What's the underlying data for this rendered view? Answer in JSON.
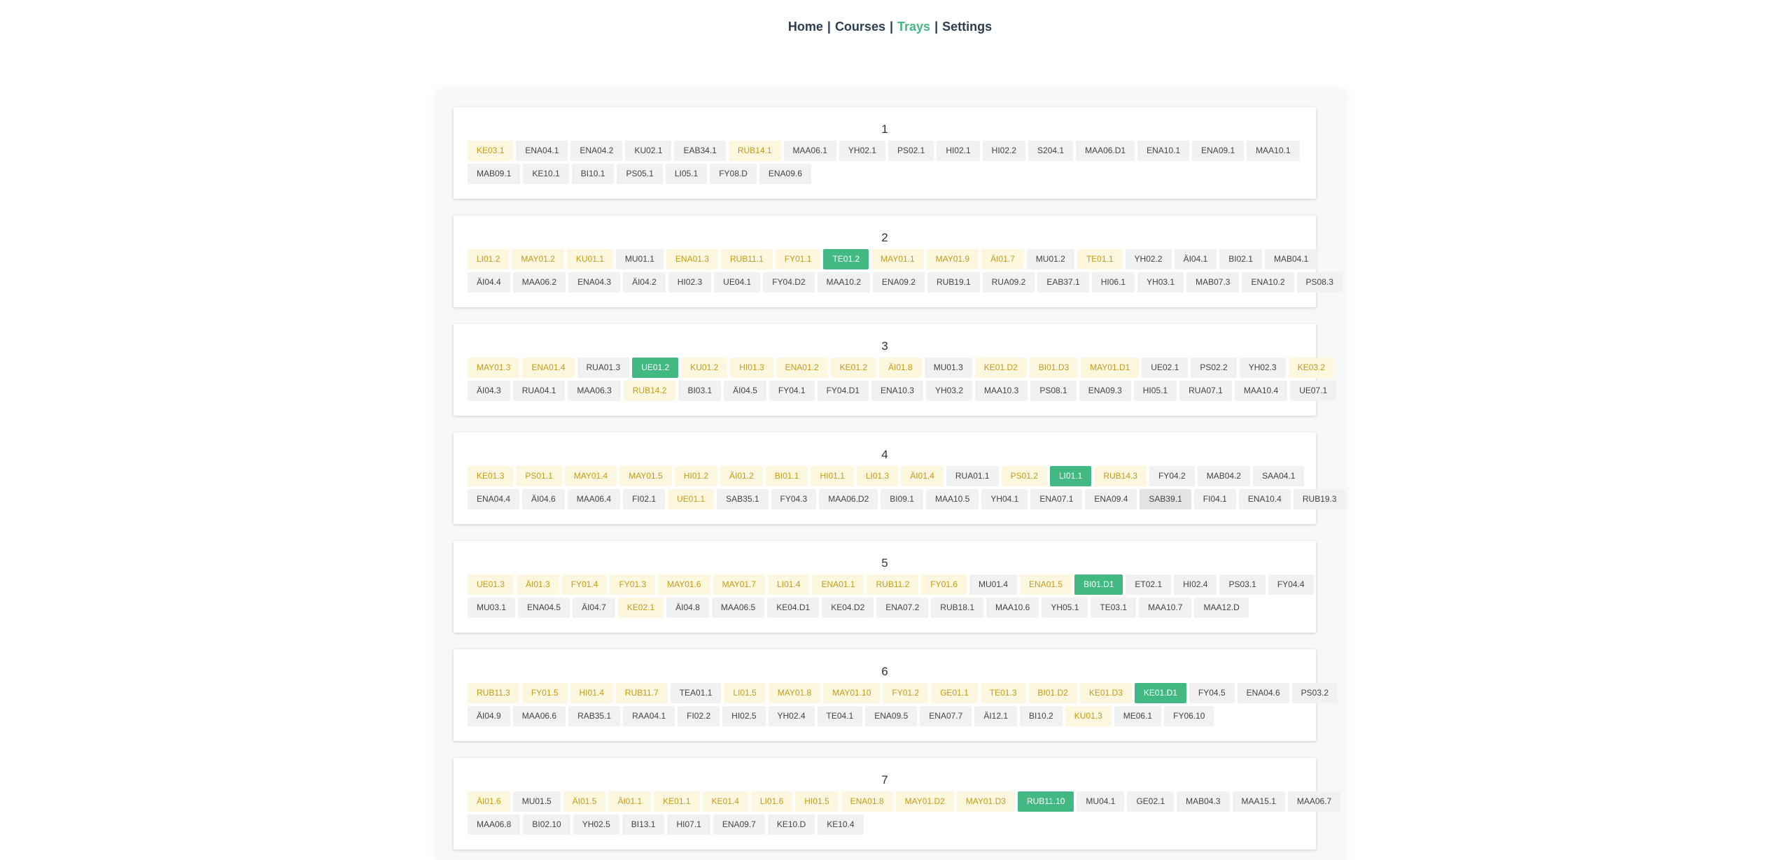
{
  "nav": {
    "items": [
      "Home",
      "Courses",
      "Trays",
      "Settings"
    ],
    "separator": "|",
    "active": "Trays",
    "active_color": "#42b983"
  },
  "legend_colors": {
    "default": "#f1f1f1",
    "yellow": "#fdf7e0",
    "green": "#42b983"
  },
  "trays": [
    {
      "title": "1",
      "rows": [
        [
          [
            "KE03.1",
            "y"
          ],
          [
            "ENA04.1",
            "n"
          ],
          [
            "ENA04.2",
            "n"
          ],
          [
            "KU02.1",
            "n"
          ],
          [
            "EAB34.1",
            "n"
          ],
          [
            "RUB14.1",
            "y"
          ],
          [
            "MAA06.1",
            "n"
          ],
          [
            "YH02.1",
            "n"
          ],
          [
            "PS02.1",
            "n"
          ],
          [
            "HI02.1",
            "n"
          ],
          [
            "HI02.2",
            "n"
          ],
          [
            "S204.1",
            "n"
          ],
          [
            "MAA06.D1",
            "n"
          ],
          [
            "ENA10.1",
            "n"
          ],
          [
            "ENA09.1",
            "n"
          ],
          [
            "MAA10.1",
            "n"
          ]
        ],
        [
          [
            "MAB09.1",
            "n"
          ],
          [
            "KE10.1",
            "n"
          ],
          [
            "BI10.1",
            "n"
          ],
          [
            "PS05.1",
            "n"
          ],
          [
            "LI05.1",
            "n"
          ],
          [
            "FY08.D",
            "n"
          ],
          [
            "ENA09.6",
            "n"
          ]
        ]
      ]
    },
    {
      "title": "2",
      "rows": [
        [
          [
            "LI01.2",
            "y"
          ],
          [
            "MAY01.2",
            "y"
          ],
          [
            "KU01.1",
            "y"
          ],
          [
            "MU01.1",
            "n"
          ],
          [
            "ENA01.3",
            "y"
          ],
          [
            "RUB11.1",
            "y"
          ],
          [
            "FY01.1",
            "y"
          ],
          [
            "TE01.2",
            "g"
          ],
          [
            "MAY01.1",
            "y"
          ],
          [
            "MAY01.9",
            "y"
          ],
          [
            "ÄI01.7",
            "y"
          ],
          [
            "MU01.2",
            "n"
          ],
          [
            "TE01.1",
            "y"
          ],
          [
            "YH02.2",
            "n"
          ],
          [
            "ÄI04.1",
            "n"
          ],
          [
            "BI02.1",
            "n"
          ],
          [
            "MAB04.1",
            "n"
          ]
        ],
        [
          [
            "ÄI04.4",
            "n"
          ],
          [
            "MAA06.2",
            "n"
          ],
          [
            "ENA04.3",
            "n"
          ],
          [
            "ÄI04.2",
            "n"
          ],
          [
            "HI02.3",
            "n"
          ],
          [
            "UE04.1",
            "n"
          ],
          [
            "FY04.D2",
            "n"
          ],
          [
            "MAA10.2",
            "n"
          ],
          [
            "ENA09.2",
            "n"
          ],
          [
            "RUB19.1",
            "n"
          ],
          [
            "RUA09.2",
            "n"
          ],
          [
            "EAB37.1",
            "n"
          ],
          [
            "HI06.1",
            "n"
          ],
          [
            "YH03.1",
            "n"
          ],
          [
            "MAB07.3",
            "n"
          ],
          [
            "ENA10.2",
            "n"
          ],
          [
            "PS08.3",
            "n"
          ]
        ]
      ]
    },
    {
      "title": "3",
      "rows": [
        [
          [
            "MAY01.3",
            "y"
          ],
          [
            "ENA01.4",
            "y"
          ],
          [
            "RUA01.3",
            "n"
          ],
          [
            "UE01.2",
            "g"
          ],
          [
            "KU01.2",
            "y"
          ],
          [
            "HI01.3",
            "y"
          ],
          [
            "ENA01.2",
            "y"
          ],
          [
            "KE01.2",
            "y"
          ],
          [
            "ÄI01.8",
            "y"
          ],
          [
            "MU01.3",
            "n"
          ],
          [
            "KE01.D2",
            "y"
          ],
          [
            "BI01.D3",
            "y"
          ],
          [
            "MAY01.D1",
            "y"
          ],
          [
            "UE02.1",
            "n"
          ],
          [
            "PS02.2",
            "n"
          ],
          [
            "YH02.3",
            "n"
          ],
          [
            "KE03.2",
            "y"
          ]
        ],
        [
          [
            "ÄI04.3",
            "n"
          ],
          [
            "RUA04.1",
            "n"
          ],
          [
            "MAA06.3",
            "n"
          ],
          [
            "RUB14.2",
            "y"
          ],
          [
            "BI03.1",
            "n"
          ],
          [
            "ÄI04.5",
            "n"
          ],
          [
            "FY04.1",
            "n"
          ],
          [
            "FY04.D1",
            "n"
          ],
          [
            "ENA10.3",
            "n"
          ],
          [
            "YH03.2",
            "n"
          ],
          [
            "MAA10.3",
            "n"
          ],
          [
            "PS08.1",
            "n"
          ],
          [
            "ENA09.3",
            "n"
          ],
          [
            "HI05.1",
            "n"
          ],
          [
            "RUA07.1",
            "n"
          ],
          [
            "MAA10.4",
            "n"
          ],
          [
            "UE07.1",
            "n"
          ]
        ]
      ]
    },
    {
      "title": "4",
      "rows": [
        [
          [
            "KE01.3",
            "y"
          ],
          [
            "PS01.1",
            "y"
          ],
          [
            "MAY01.4",
            "y"
          ],
          [
            "MAY01.5",
            "y"
          ],
          [
            "HI01.2",
            "y"
          ],
          [
            "ÄI01.2",
            "y"
          ],
          [
            "BI01.1",
            "y"
          ],
          [
            "HI01.1",
            "y"
          ],
          [
            "LI01.3",
            "y"
          ],
          [
            "ÄI01.4",
            "y"
          ],
          [
            "RUA01.1",
            "n"
          ],
          [
            "PS01.2",
            "y"
          ],
          [
            "LI01.1",
            "g"
          ],
          [
            "RUB14.3",
            "y"
          ],
          [
            "FY04.2",
            "n"
          ],
          [
            "MAB04.2",
            "n"
          ],
          [
            "SAA04.1",
            "n"
          ]
        ],
        [
          [
            "ENA04.4",
            "n"
          ],
          [
            "ÄI04.6",
            "n"
          ],
          [
            "MAA06.4",
            "n"
          ],
          [
            "FI02.1",
            "n"
          ],
          [
            "UE01.1",
            "y"
          ],
          [
            "SAB35.1",
            "n"
          ],
          [
            "FY04.3",
            "n"
          ],
          [
            "MAA06.D2",
            "n"
          ],
          [
            "BI09.1",
            "n"
          ],
          [
            "MAA10.5",
            "n"
          ],
          [
            "YH04.1",
            "n"
          ],
          [
            "ENA07.1",
            "n"
          ],
          [
            "ENA09.4",
            "n"
          ],
          [
            "SAB39.1",
            "d"
          ],
          [
            "FI04.1",
            "n"
          ],
          [
            "ENA10.4",
            "n"
          ],
          [
            "RUB19.3",
            "n"
          ]
        ]
      ]
    },
    {
      "title": "5",
      "rows": [
        [
          [
            "UE01.3",
            "y"
          ],
          [
            "ÄI01.3",
            "y"
          ],
          [
            "FY01.4",
            "y"
          ],
          [
            "FY01.3",
            "y"
          ],
          [
            "MAY01.6",
            "y"
          ],
          [
            "MAY01.7",
            "y"
          ],
          [
            "LI01.4",
            "y"
          ],
          [
            "ENA01.1",
            "y"
          ],
          [
            "RUB11.2",
            "y"
          ],
          [
            "FY01.6",
            "y"
          ],
          [
            "MU01.4",
            "n"
          ],
          [
            "ENA01.5",
            "y"
          ],
          [
            "BI01.D1",
            "g"
          ],
          [
            "ET02.1",
            "n"
          ],
          [
            "HI02.4",
            "n"
          ],
          [
            "PS03.1",
            "n"
          ],
          [
            "FY04.4",
            "n"
          ]
        ],
        [
          [
            "MU03.1",
            "n"
          ],
          [
            "ENA04.5",
            "n"
          ],
          [
            "ÄI04.7",
            "n"
          ],
          [
            "KE02.1",
            "y"
          ],
          [
            "ÄI04.8",
            "n"
          ],
          [
            "MAA06.5",
            "n"
          ],
          [
            "KE04.D1",
            "n"
          ],
          [
            "KE04.D2",
            "n"
          ],
          [
            "ENA07.2",
            "n"
          ],
          [
            "RUB18.1",
            "n"
          ],
          [
            "MAA10.6",
            "n"
          ],
          [
            "YH05.1",
            "n"
          ],
          [
            "TE03.1",
            "n"
          ],
          [
            "MAA10.7",
            "n"
          ],
          [
            "MAA12.D",
            "n"
          ]
        ]
      ]
    },
    {
      "title": "6",
      "rows": [
        [
          [
            "RUB11.3",
            "y"
          ],
          [
            "FY01.5",
            "y"
          ],
          [
            "HI01.4",
            "y"
          ],
          [
            "RUB11.7",
            "y"
          ],
          [
            "TEA01.1",
            "n"
          ],
          [
            "LI01.5",
            "y"
          ],
          [
            "MAY01.8",
            "y"
          ],
          [
            "MAY01.10",
            "y"
          ],
          [
            "FY01.2",
            "y"
          ],
          [
            "GE01.1",
            "y"
          ],
          [
            "TE01.3",
            "y"
          ],
          [
            "BI01.D2",
            "y"
          ],
          [
            "KE01.D3",
            "y"
          ],
          [
            "KE01.D1",
            "g"
          ],
          [
            "FY04.5",
            "n"
          ],
          [
            "ENA04.6",
            "n"
          ],
          [
            "PS03.2",
            "n"
          ]
        ],
        [
          [
            "ÄI04.9",
            "n"
          ],
          [
            "MAA06.6",
            "n"
          ],
          [
            "RAB35.1",
            "n"
          ],
          [
            "RAA04.1",
            "n"
          ],
          [
            "FI02.2",
            "n"
          ],
          [
            "HI02.5",
            "n"
          ],
          [
            "YH02.4",
            "n"
          ],
          [
            "TE04.1",
            "n"
          ],
          [
            "ENA09.5",
            "n"
          ],
          [
            "ENA07.7",
            "n"
          ],
          [
            "ÄI12.1",
            "n"
          ],
          [
            "BI10.2",
            "n"
          ],
          [
            "KU01.3",
            "y"
          ],
          [
            "ME06.1",
            "n"
          ],
          [
            "FY06.10",
            "n"
          ]
        ]
      ]
    },
    {
      "title": "7",
      "rows": [
        [
          [
            "ÄI01.6",
            "y"
          ],
          [
            "MU01.5",
            "n"
          ],
          [
            "ÄI01.5",
            "y"
          ],
          [
            "ÄI01.1",
            "y"
          ],
          [
            "KE01.1",
            "y"
          ],
          [
            "KE01.4",
            "y"
          ],
          [
            "LI01.6",
            "y"
          ],
          [
            "HI01.5",
            "y"
          ],
          [
            "ENA01.8",
            "y"
          ],
          [
            "MAY01.D2",
            "y"
          ],
          [
            "MAY01.D3",
            "y"
          ],
          [
            "RUB11.10",
            "g"
          ],
          [
            "MU04.1",
            "n"
          ],
          [
            "GE02.1",
            "n"
          ],
          [
            "MAB04.3",
            "n"
          ],
          [
            "MAA15.1",
            "n"
          ],
          [
            "MAA06.7",
            "n"
          ]
        ],
        [
          [
            "MAA06.8",
            "n"
          ],
          [
            "BI02.10",
            "n"
          ],
          [
            "YH02.5",
            "n"
          ],
          [
            "BI13.1",
            "n"
          ],
          [
            "HI07.1",
            "n"
          ],
          [
            "ENA09.7",
            "n"
          ],
          [
            "KE10.D",
            "n"
          ],
          [
            "KE10.4",
            "n"
          ]
        ]
      ]
    }
  ]
}
